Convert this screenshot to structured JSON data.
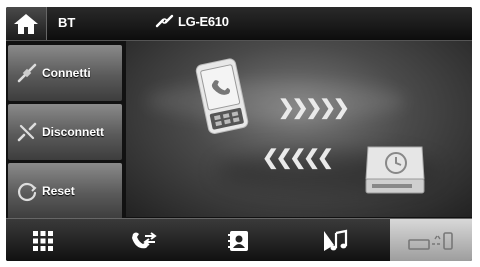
{
  "header": {
    "mode_label": "BT",
    "device_name": "LG-E610"
  },
  "sidebar": {
    "buttons": [
      {
        "label": "Connetti",
        "icon": "connect-plug-icon"
      },
      {
        "label": "Disconnett",
        "icon": "disconnect-plug-icon"
      },
      {
        "label": "Reset",
        "icon": "reset-circle-icon"
      }
    ]
  },
  "main": {
    "phone_icon": "mobile-phone-icon",
    "unit_icon": "head-unit-icon",
    "arrows_right": "❯❯❯❯❯",
    "arrows_left": "❮❮❮❮❮"
  },
  "bottom": {
    "items": [
      "keypad-icon",
      "call-log-icon",
      "contacts-icon",
      "music-icon",
      "pairing-icon"
    ],
    "active_index": 4
  },
  "colors": {
    "bar_dark": "#0d0d0d",
    "button_gray": "#6a6a6a",
    "active_tab": "#c8c8c8"
  }
}
